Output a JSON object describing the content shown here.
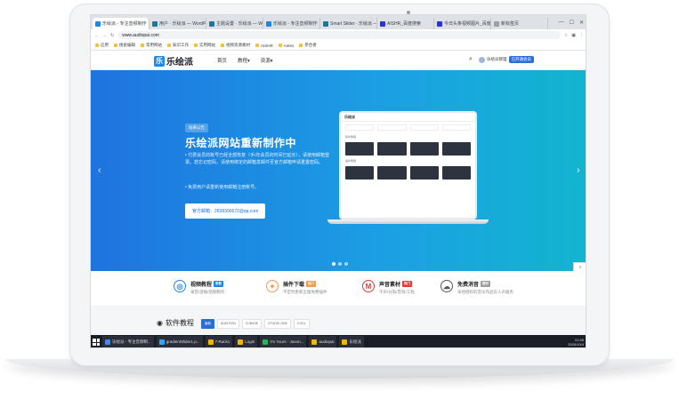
{
  "browser": {
    "tabs": [
      {
        "label": "乐绘派 - 专注音频制作",
        "active": true,
        "color": "#1e88e5"
      },
      {
        "label": "用户 · 乐绘派 — WordPress",
        "active": false,
        "color": "#21759b"
      },
      {
        "label": "主题设置 · 乐绘派 — Wo…",
        "active": false,
        "color": "#21759b"
      },
      {
        "label": "乐绘派 - 专注音频制作",
        "active": false,
        "color": "#1e88e5"
      },
      {
        "label": "Smart Slider · 乐绘派 — W…",
        "active": false,
        "color": "#21759b"
      },
      {
        "label": "AISHR_百度搜索",
        "active": false,
        "color": "#2932e1"
      },
      {
        "label": "今日头条视频图片_百度搜…",
        "active": false,
        "color": "#2932e1"
      },
      {
        "label": "新标签页",
        "active": false,
        "color": "#9aa0a6"
      }
    ],
    "url": "www.audiopai.com",
    "bookmarks": [
      "应用",
      "搜索编辑",
      "常用网站",
      "知识工作",
      "实用网站",
      "视频资源素材",
      "AISHR",
      "Antes",
      "参合者"
    ],
    "window_controls": [
      "—",
      "☐",
      "✕"
    ]
  },
  "site": {
    "logo_text": "乐绘派",
    "logo_glyph": "乐",
    "nav": [
      "首页",
      "教程▾",
      "资源▾"
    ],
    "user_name": "乐绘派管理",
    "vip_label": "已开通会员"
  },
  "hero": {
    "badge": "站来公告",
    "title": "乐绘派网站重新制作中",
    "para1": "• 付费会员的账号已经全部恢复（手/年会员的时间已延长），请使用邮箱登录。若忘记密码，请使用绑定的邮箱发邮件至官方邮箱申请重置密码。",
    "para2": "• 免费用户请重新使用邮箱注册账号。",
    "button": "官方邮箱：2638300672@qq.com",
    "mock_logo": "乐绘派",
    "mock_section1": "软件教程",
    "mock_section2": "插件教程"
  },
  "features": [
    {
      "title": "视频教程",
      "tag": "更新",
      "desc": "录音/混缩/后期制作",
      "color": "#1e88e5",
      "tagcolor": "#1e88e5",
      "glyph": "◎"
    },
    {
      "title": "插件下载",
      "tag": "热门",
      "desc": "不定时更新正版免费插件",
      "color": "#f2994a",
      "tagcolor": "#f2994a",
      "glyph": "✦"
    },
    {
      "title": "声音素材",
      "tag": "热门",
      "desc": "干声/分轨/音效/工程",
      "color": "#e53935",
      "tagcolor": "#e53935",
      "glyph": "M"
    },
    {
      "title": "免费消音",
      "tag": "限时",
      "desc": "未经授权的音乐作品仅人声服务",
      "color": "#555555",
      "tagcolor": "#9e9e9e",
      "glyph": "☁"
    }
  ],
  "section": {
    "title": "软件教程",
    "chips": [
      "最新",
      "AUDITION",
      "CUBASE",
      "STUDIO ONE",
      "COOL"
    ]
  },
  "taskbar": {
    "apps": [
      {
        "label": "乐绘派 - 专注音频制...",
        "color": "#4285f4"
      },
      {
        "label": "gradientSlider1.p...",
        "color": "#31a8ff"
      },
      {
        "label": "7-Rack1",
        "color": "#f7b500"
      },
      {
        "label": "Login",
        "color": "#f7b500"
      },
      {
        "label": "I'm Yours - Jason...",
        "color": "#1db954"
      },
      {
        "label": "audiopai",
        "color": "#f7b500"
      },
      {
        "label": "乐绘派",
        "color": "#f7b500"
      }
    ],
    "time": "21:06",
    "date": "2020/10/4"
  }
}
